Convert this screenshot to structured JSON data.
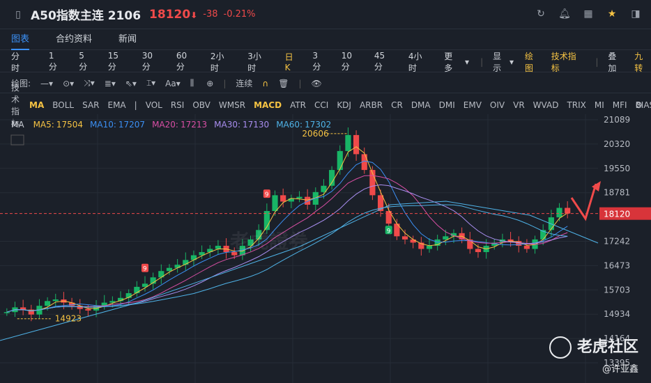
{
  "header": {
    "title": "A50指数主连 2106",
    "price": "18120",
    "price_arrow": "⬇",
    "change": "-38",
    "change_pct": "-0.21%"
  },
  "tabs": [
    "图表",
    "合约资料",
    "新闻"
  ],
  "periods": [
    "分时",
    "1分",
    "5分",
    "15分",
    "30分",
    "60分",
    "2小时",
    "3小时",
    "日K",
    "3分",
    "10分",
    "45分",
    "4小时",
    "更多"
  ],
  "period_active": "日K",
  "period_right": {
    "display": "显示",
    "draw": "绘图",
    "indicators": "技术指标",
    "overlay": "叠加",
    "nine": "九转"
  },
  "draw_tools": {
    "label": "绘图:",
    "mode": "连续"
  },
  "indicators": {
    "label": "技术指标:",
    "items": [
      "MA",
      "BOLL",
      "SAR",
      "EMA",
      "|",
      "VOL",
      "RSI",
      "OBV",
      "WMSR",
      "MACD",
      "ATR",
      "CCI",
      "KDJ",
      "ARBR",
      "CR",
      "DMA",
      "DMI",
      "EMV",
      "OIV",
      "VR",
      "WVAD",
      "TRIX",
      "MI",
      "MFI",
      "BIAS"
    ],
    "active": [
      "MA",
      "MACD"
    ]
  },
  "ma_legend": [
    {
      "label": "MA",
      "value": "",
      "color": "#c8ccd3"
    },
    {
      "label": "MA5:",
      "value": "17504",
      "color": "#f6c343"
    },
    {
      "label": "MA10:",
      "value": "17207",
      "color": "#3b8ff3"
    },
    {
      "label": "MA20:",
      "value": "17213",
      "color": "#d94fa5"
    },
    {
      "label": "MA30:",
      "value": "17130",
      "color": "#a98ef0"
    },
    {
      "label": "MA60:",
      "value": "17302",
      "color": "#4fb3e8"
    }
  ],
  "price_axis": [
    "21089",
    "20320",
    "19550",
    "18781",
    "18120",
    "17242",
    "16473",
    "15703",
    "14934",
    "14164",
    "13395"
  ],
  "annotations": {
    "high": "20606",
    "low": "14923",
    "nine_a": "9",
    "nine_b": "9",
    "nine_c": "9"
  },
  "watermarks": {
    "brand": "老虎證券",
    "community": "老虎社区",
    "author": "@许亚鑫"
  },
  "colors": {
    "up": "#18b566",
    "down": "#f04a4a",
    "accent": "#3b8ff3",
    "highlight": "#f6c343"
  },
  "chart_data": {
    "type": "candlestick",
    "y_ticks": [
      21089,
      20320,
      19550,
      18781,
      17242,
      16473,
      15703,
      14934,
      14164,
      13395
    ],
    "last_price": 18120,
    "high": 20606,
    "low": 14923,
    "closes": [
      15000,
      15150,
      15080,
      14923,
      15200,
      15350,
      15400,
      15300,
      15200,
      15100,
      15050,
      15200,
      15300,
      15350,
      15450,
      15600,
      15800,
      15900,
      16100,
      16300,
      16400,
      16500,
      16650,
      16800,
      16900,
      17000,
      17100,
      16900,
      16800,
      17100,
      17300,
      17600,
      18200,
      18700,
      18500,
      18600,
      18650,
      18400,
      18800,
      19000,
      19500,
      20100,
      20606,
      20000,
      19500,
      18700,
      18200,
      17800,
      17400,
      17300,
      17200,
      17000,
      17100,
      17300,
      17400,
      17500,
      17300,
      17000,
      16900,
      17100,
      17200,
      17300,
      17250,
      17100,
      17000,
      17300,
      17600,
      18000,
      18300,
      18120
    ],
    "ma_series": [
      "MA5",
      "MA10",
      "MA20",
      "MA30",
      "MA60"
    ]
  }
}
